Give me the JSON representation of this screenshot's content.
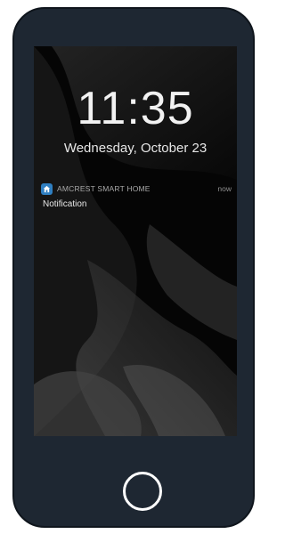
{
  "lock_screen": {
    "time": "11:35",
    "date": "Wednesday, October 23"
  },
  "notification": {
    "app_name": "AMCREST SMART HOME",
    "timestamp": "now",
    "message": "Notification",
    "app_icon": "home-icon",
    "app_icon_color": "#2f7fc1"
  },
  "device": {
    "frame_color": "#1e2732",
    "home_button_icon": "circle-icon"
  }
}
